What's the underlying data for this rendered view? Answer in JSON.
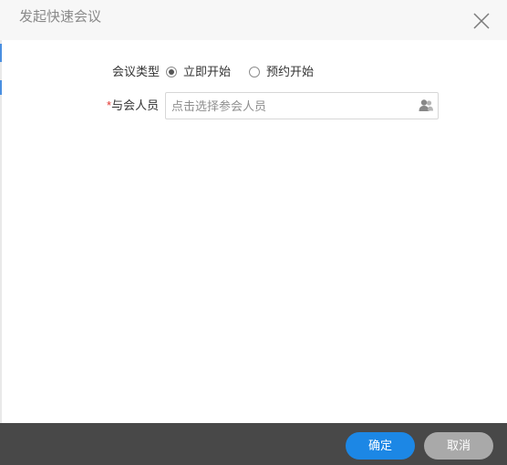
{
  "dialog": {
    "title": "发起快速会议",
    "close_icon": "close-icon"
  },
  "form": {
    "meeting_type": {
      "label": "会议类型",
      "options": [
        {
          "label": "立即开始",
          "selected": true
        },
        {
          "label": "预约开始",
          "selected": false
        }
      ]
    },
    "participants": {
      "required_mark": "*",
      "label": "与会人员",
      "placeholder": "点击选择参会人员",
      "value": "",
      "icon": "select-contacts-icon"
    }
  },
  "footer": {
    "confirm_label": "确定",
    "cancel_label": "取消"
  },
  "colors": {
    "primary": "#1c87e5",
    "cancel": "#a9a9a9",
    "footer_bg": "#484848",
    "required": "#e3342f",
    "header_bg": "#f7f7f7"
  }
}
